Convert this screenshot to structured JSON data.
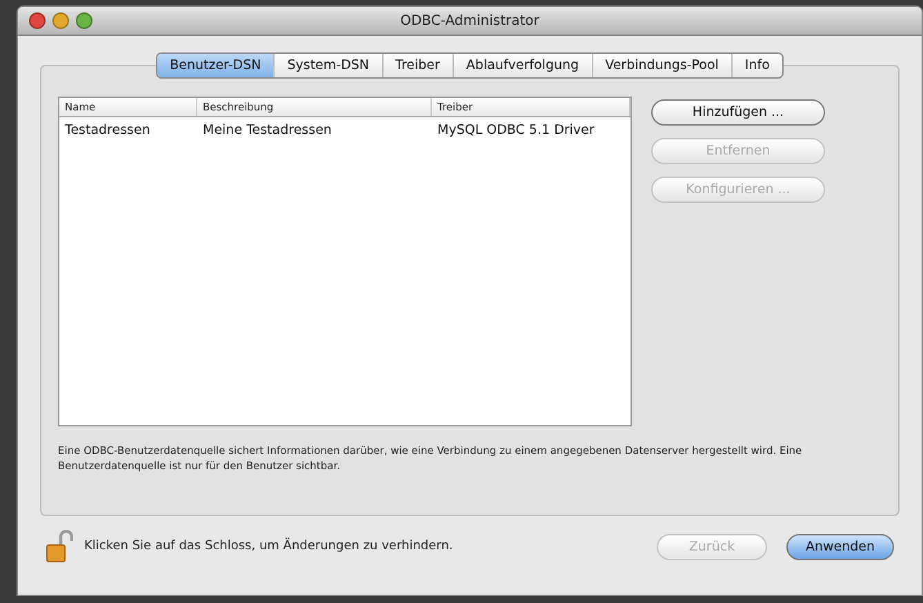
{
  "window": {
    "title": "ODBC-Administrator"
  },
  "tabs": [
    {
      "label": "Benutzer-DSN",
      "selected": true
    },
    {
      "label": "System-DSN",
      "selected": false
    },
    {
      "label": "Treiber",
      "selected": false
    },
    {
      "label": "Ablaufverfolgung",
      "selected": false
    },
    {
      "label": "Verbindungs-Pool",
      "selected": false
    },
    {
      "label": "Info",
      "selected": false
    }
  ],
  "table": {
    "columns": [
      "Name",
      "Beschreibung",
      "Treiber"
    ],
    "rows": [
      [
        "Testadressen",
        "Meine Testadressen",
        "MySQL ODBC 5.1 Driver"
      ]
    ]
  },
  "side_buttons": [
    {
      "label": "Hinzufügen ...",
      "disabled": false
    },
    {
      "label": "Entfernen",
      "disabled": true
    },
    {
      "label": "Konfigurieren ...",
      "disabled": true
    }
  ],
  "description": "Eine ODBC-Benutzerdatenquelle sichert Informationen darüber, wie eine Verbindung zu einem angegebenen Datenserver hergestellt wird. Eine Benutzerdatenquelle ist nur für den Benutzer sichtbar.",
  "lock": {
    "unlocked": true,
    "text": "Klicken Sie auf das Schloss, um Änderungen zu verhindern."
  },
  "footer_buttons": [
    {
      "label": "Zurück",
      "disabled": true,
      "default": false
    },
    {
      "label": "Anwenden",
      "disabled": false,
      "default": true
    }
  ]
}
